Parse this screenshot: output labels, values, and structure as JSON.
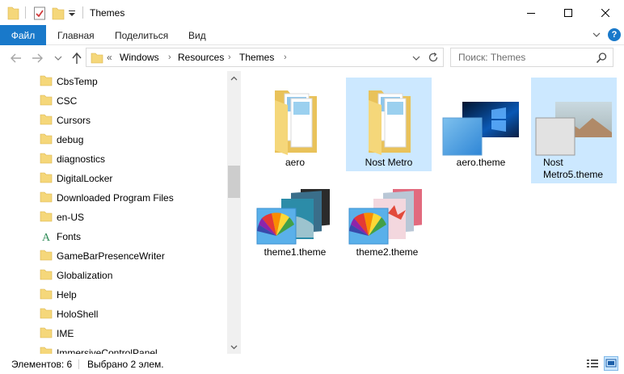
{
  "window": {
    "title": "Themes"
  },
  "ribbon": {
    "tabs": [
      {
        "label": "Файл"
      },
      {
        "label": "Главная"
      },
      {
        "label": "Поделиться"
      },
      {
        "label": "Вид"
      }
    ],
    "help_label": "?"
  },
  "address": {
    "overflow": "«",
    "crumbs": [
      "Windows",
      "Resources",
      "Themes"
    ]
  },
  "search": {
    "placeholder": "Поиск: Themes"
  },
  "tree": {
    "items": [
      {
        "label": "CbsTemp",
        "icon": "folder-icon"
      },
      {
        "label": "CSC",
        "icon": "folder-icon"
      },
      {
        "label": "Cursors",
        "icon": "folder-icon"
      },
      {
        "label": "debug",
        "icon": "folder-icon"
      },
      {
        "label": "diagnostics",
        "icon": "folder-icon"
      },
      {
        "label": "DigitalLocker",
        "icon": "folder-icon"
      },
      {
        "label": "Downloaded Program Files",
        "icon": "folder-icon"
      },
      {
        "label": "en-US",
        "icon": "folder-icon"
      },
      {
        "label": "Fonts",
        "icon": "fonts-folder-icon"
      },
      {
        "label": "GameBarPresenceWriter",
        "icon": "folder-icon"
      },
      {
        "label": "Globalization",
        "icon": "folder-icon"
      },
      {
        "label": "Help",
        "icon": "folder-icon"
      },
      {
        "label": "HoloShell",
        "icon": "folder-icon"
      },
      {
        "label": "IME",
        "icon": "folder-icon"
      },
      {
        "label": "ImmersiveControlPanel",
        "icon": "folder-icon"
      }
    ]
  },
  "files": [
    {
      "label": "aero",
      "kind": "folder",
      "selected": false
    },
    {
      "label": "Nost Metro",
      "kind": "folder",
      "selected": true
    },
    {
      "label": "aero.theme",
      "kind": "theme",
      "selected": false
    },
    {
      "label": "Nost Metro5.theme",
      "kind": "theme",
      "selected": true
    },
    {
      "label": "theme1.theme",
      "kind": "theme",
      "selected": false
    },
    {
      "label": "theme2.theme",
      "kind": "theme",
      "selected": false
    }
  ],
  "status": {
    "count": "Элементов: 6",
    "selection": "Выбрано 2 элем."
  },
  "colors": {
    "accent": "#1979ca",
    "selection": "#cce8ff",
    "folder": "#f5d77a"
  }
}
